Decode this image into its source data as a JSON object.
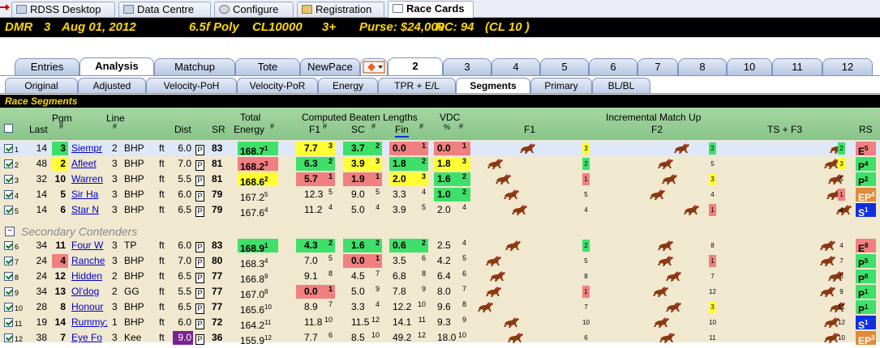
{
  "window_tabs": [
    {
      "label": "RDSS Desktop",
      "icon": "desktop-icon"
    },
    {
      "label": "Data Centre",
      "icon": "database-icon"
    },
    {
      "label": "Configure",
      "icon": "gear-icon"
    },
    {
      "label": "Registration",
      "icon": "registration-icon"
    },
    {
      "label": "Race Cards",
      "icon": "race-cards-icon",
      "active": true
    }
  ],
  "race_header": {
    "track": "DMR",
    "race": "3",
    "date": "Aug 01, 2012",
    "distance_surface": "6.5f Poly",
    "class": "CL10000",
    "age": "3+",
    "purse": "Purse: $24,000",
    "rc": "RC: 94",
    "cl": "(CL 10 )"
  },
  "main_tabs": [
    "Entries",
    "Analysis",
    "Matchup",
    "Tote",
    "NewPace"
  ],
  "race_tabs": [
    "2",
    "3",
    "4",
    "5",
    "6",
    "7",
    "8",
    "10",
    "11",
    "12"
  ],
  "sub_tabs": [
    "Original",
    "Adjusted",
    "Velocity-PoH",
    "Velocity-PoR",
    "Energy",
    "TPR + E/L",
    "Segments",
    "Primary",
    "BL/BL"
  ],
  "section_title": "Race Segments",
  "headers": {
    "pgm": "Pgm",
    "pgm_hash": "#",
    "last": "Last",
    "line": "Line",
    "line_hash": "#",
    "dist": "Dist",
    "sr": "SR",
    "total": "Total",
    "energy": "Energy",
    "energy_hash": "#",
    "cbl": "Computed Beaten Lengths",
    "f1": "F1",
    "sc": "SC",
    "fin": "Fin",
    "hash": "#",
    "vdc": "VDC",
    "vdc_pct": "%",
    "vdc_hash": "#",
    "imu": "Incremental Match Up",
    "imu_f1": "F1",
    "imu_f2": "F2",
    "ts_f3": "TS + F3",
    "rs": "RS"
  },
  "secondary_label": "Secondary Contenders",
  "rows": [
    {
      "idx": "1",
      "last": "14",
      "pgm": "3",
      "name": "Siempr",
      "line": "2",
      "ln": "BHP",
      "u": "ft",
      "dist": "6.0",
      "p": "P",
      "sr": "83",
      "en": "168.7",
      "enr": "1",
      "f1": "7.7",
      "f1r": "3",
      "sc": "3.7",
      "scr": "2",
      "fin": "0.0",
      "finr": "1",
      "vdc": "0.0",
      "vdcr": "1",
      "m1": "3",
      "m2": "2",
      "m3": "2",
      "rs": "E",
      "rsn": "5",
      "sel": true
    },
    {
      "idx": "2",
      "last": "48",
      "pgm": "2",
      "name": "Afleet",
      "line": "3",
      "ln": "BHP",
      "u": "ft",
      "dist": "7.0",
      "p": "P",
      "sr": "81",
      "en": "168.2",
      "enr": "3",
      "f1": "6.3",
      "f1r": "2",
      "sc": "3.9",
      "scr": "3",
      "fin": "1.8",
      "finr": "2",
      "vdc": "1.8",
      "vdcr": "3",
      "m1": "2",
      "m2": "5",
      "m3": "3",
      "rs": "P",
      "rsn": "4"
    },
    {
      "idx": "3",
      "last": "32",
      "pgm": "10",
      "name": "Warren",
      "line": "3",
      "ln": "BHP",
      "u": "ft",
      "dist": "5.5",
      "p": "P",
      "sr": "81",
      "en": "168.6",
      "enr": "2",
      "f1": "5.7",
      "f1r": "1",
      "sc": "1.9",
      "scr": "1",
      "fin": "2.0",
      "finr": "3",
      "vdc": "1.6",
      "vdcr": "2",
      "m1": "1",
      "m2": "3",
      "m3": "5",
      "rs": "P",
      "rsn": "2"
    },
    {
      "idx": "4",
      "last": "14",
      "pgm": "5",
      "name": "Sir Ha",
      "line": "3",
      "ln": "BHP",
      "u": "ft",
      "dist": "6.0",
      "p": "P",
      "sr": "79",
      "en": "167.2",
      "enr": "5",
      "f1": "12.3",
      "f1r": "5",
      "sc": "9.0",
      "scr": "5",
      "fin": "3.3",
      "finr": "4",
      "vdc": "1.0",
      "vdcr": "2",
      "m1": "5",
      "m2": "4",
      "m3": "1",
      "rs": "EP",
      "rsn": "4"
    },
    {
      "idx": "5",
      "last": "14",
      "pgm": "6",
      "name": "Star N",
      "line": "3",
      "ln": "BHP",
      "u": "ft",
      "dist": "6.5",
      "p": "P",
      "sr": "79",
      "en": "167.6",
      "enr": "4",
      "f1": "11.2",
      "f1r": "4",
      "sc": "5.0",
      "scr": "4",
      "fin": "3.9",
      "finr": "5",
      "vdc": "2.0",
      "vdcr": "4",
      "m1": "4",
      "m2": "1",
      "m3": "4",
      "rs": "S",
      "rsn": "1"
    },
    {
      "idx": "6",
      "last": "34",
      "pgm": "11",
      "name": "Four W",
      "line": "3",
      "ln": "TP",
      "u": "ft",
      "dist": "6.0",
      "p": "P",
      "sr": "83",
      "en": "168.9",
      "enr": "1",
      "f1": "4.3",
      "f1r": "2",
      "sc": "1.6",
      "scr": "2",
      "fin": "0.6",
      "finr": "2",
      "vdc": "2.5",
      "vdcr": "4",
      "m1": "2",
      "m2": "8",
      "m3": "4",
      "rs": "E",
      "rsn": "8"
    },
    {
      "idx": "7",
      "last": "24",
      "pgm": "4",
      "name": "Ranche",
      "line": "3",
      "ln": "BHP",
      "u": "ft",
      "dist": "7.0",
      "p": "P",
      "sr": "80",
      "en": "168.3",
      "enr": "4",
      "f1": "7.0",
      "f1r": "5",
      "sc": "0.0",
      "scr": "1",
      "fin": "3.5",
      "finr": "6",
      "vdc": "4.2",
      "vdcr": "5",
      "m1": "5",
      "m2": "1",
      "m3": "7",
      "rs": "P",
      "rsn": "5"
    },
    {
      "idx": "8",
      "last": "24",
      "pgm": "12",
      "name": "Hidden",
      "line": "2",
      "ln": "BHP",
      "u": "ft",
      "dist": "6.5",
      "p": "P",
      "sr": "77",
      "en": "166.8",
      "enr": "9",
      "f1": "9.1",
      "f1r": "8",
      "sc": "4.5",
      "scr": "7",
      "fin": "6.8",
      "finr": "8",
      "vdc": "6.4",
      "vdcr": "6",
      "m1": "8",
      "m2": "7",
      "m3": "8",
      "rs": "P",
      "rsn": "6"
    },
    {
      "idx": "9",
      "last": "34",
      "pgm": "13",
      "name": "Ol'dog",
      "line": "2",
      "ln": "GG",
      "u": "ft",
      "dist": "5.5",
      "p": "P",
      "sr": "77",
      "en": "167.0",
      "enr": "8",
      "f1": "0.0",
      "f1r": "1",
      "sc": "5.0",
      "scr": "9",
      "fin": "7.8",
      "finr": "9",
      "vdc": "8.0",
      "vdcr": "7",
      "m1": "1",
      "m2": "12",
      "m3": "9",
      "rs": "P",
      "rsn": "1"
    },
    {
      "idx": "10",
      "last": "28",
      "pgm": "8",
      "name": "Honour",
      "line": "3",
      "ln": "BHP",
      "u": "ft",
      "dist": "6.5",
      "p": "P",
      "sr": "77",
      "en": "165.6",
      "enr": "10",
      "f1": "8.9",
      "f1r": "7",
      "sc": "3.3",
      "scr": "4",
      "fin": "12.2",
      "finr": "10",
      "vdc": "9.6",
      "vdcr": "8",
      "m1": "7",
      "m2": "3",
      "m3": "11",
      "rs": "P",
      "rsn": "1"
    },
    {
      "idx": "11",
      "last": "19",
      "pgm": "14",
      "name": "Rummy:",
      "line": "1",
      "ln": "BHP",
      "u": "ft",
      "dist": "6.0",
      "p": "P",
      "sr": "72",
      "en": "164.2",
      "enr": "11",
      "f1": "11.8",
      "f1r": "10",
      "sc": "11.5",
      "scr": "12",
      "fin": "14.1",
      "finr": "11",
      "vdc": "9.3",
      "vdcr": "9",
      "m1": "10",
      "m2": "10",
      "m3": "12",
      "rs": "S",
      "rsn": "1"
    },
    {
      "idx": "12",
      "last": "38",
      "pgm": "7",
      "name": "Eye Fo",
      "line": "3",
      "ln": "Kee",
      "u": "ft",
      "dist": "9.0",
      "p": "P",
      "sr": "36",
      "en": "155.9",
      "enr": "12",
      "f1": "7.7",
      "f1r": "6",
      "sc": "8.5",
      "scr": "10",
      "fin": "49.2",
      "finr": "12",
      "vdc": "18.0",
      "vdcr": "10",
      "m1": "6",
      "m2": "11",
      "m3": "10",
      "rs": "EP",
      "rsn": "3"
    }
  ],
  "colors": {
    "green": "#3ee06a",
    "yellow": "#ffff33",
    "red": "#f08080",
    "purple": "#7a2090",
    "blue": "#1030e0",
    "orange": "#e08a3a"
  }
}
